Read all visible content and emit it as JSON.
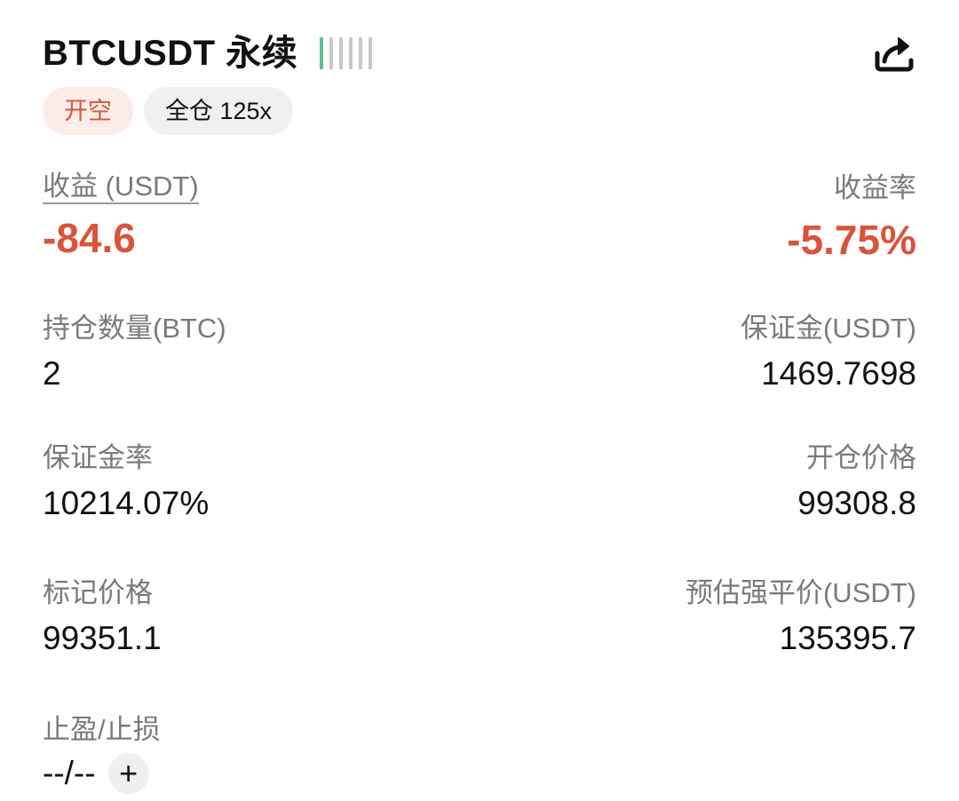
{
  "header": {
    "title": "BTCUSDT 永续",
    "signal_level": 1,
    "signal_bars": 6
  },
  "tags": {
    "side": "开空",
    "margin_mode": "全仓 125x"
  },
  "pnl": {
    "label": "收益 (USDT)",
    "value": "-84.6",
    "rate_label": "收益率",
    "rate_value": "-5.75%"
  },
  "fields": {
    "size_label": "持仓数量(BTC)",
    "size_value": "2",
    "margin_label": "保证金(USDT)",
    "margin_value": "1469.7698",
    "margin_ratio_label": "保证金率",
    "margin_ratio_value": "10214.07%",
    "entry_price_label": "开仓价格",
    "entry_price_value": "99308.8",
    "mark_price_label": "标记价格",
    "mark_price_value": "99351.1",
    "liq_price_label": "预估强平价(USDT)",
    "liq_price_value": "135395.7",
    "tpsl_label": "止盈/止损",
    "tpsl_value": "--/--",
    "add_symbol": "+"
  },
  "colors": {
    "negative": "#d9543a",
    "signal_on": "#5fbf8f",
    "signal_off": "#c8c8c8"
  },
  "icons": {
    "share": "share-icon",
    "add": "plus-icon"
  }
}
